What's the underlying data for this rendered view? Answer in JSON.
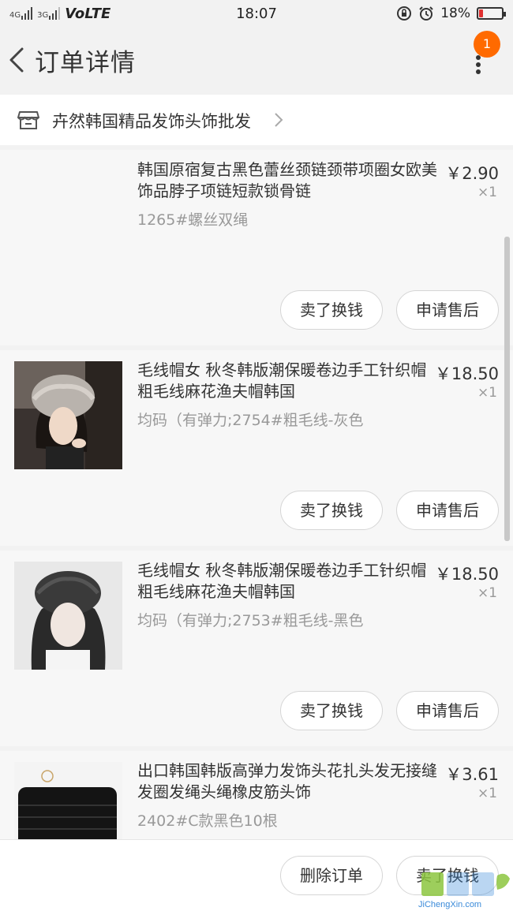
{
  "status_bar": {
    "signal_a": "4G",
    "signal_b": "3G",
    "network": "VoLTE",
    "time": "18:07",
    "battery_percent": "18%",
    "battery_level": 0.18
  },
  "nav": {
    "title": "订单详情",
    "badge_count": "1"
  },
  "shop": {
    "name": "卉然韩国精品发饰头饰批发"
  },
  "items": [
    {
      "title": "韩国原宿复古黑色蕾丝颈链颈带项圈女欧美饰品脖子项链短款锁骨链",
      "sku": "1265#螺丝双绳",
      "price": "￥2.90",
      "qty": "×1",
      "btn_sell": "卖了换钱",
      "btn_after": "申请售后"
    },
    {
      "title": "毛线帽女 秋冬韩版潮保暖卷边手工针织帽粗毛线麻花渔夫帽韩国",
      "sku": "均码（有弹力;2754#粗毛线-灰色",
      "price": "￥18.50",
      "qty": "×1",
      "btn_sell": "卖了换钱",
      "btn_after": "申请售后"
    },
    {
      "title": "毛线帽女 秋冬韩版潮保暖卷边手工针织帽粗毛线麻花渔夫帽韩国",
      "sku": "均码（有弹力;2753#粗毛线-黑色",
      "price": "￥18.50",
      "qty": "×1",
      "btn_sell": "卖了换钱",
      "btn_after": "申请售后"
    },
    {
      "title": "出口韩国韩版高弹力发饰头花扎头发无接缝发圈发绳头绳橡皮筋头饰",
      "sku": "2402#C款黑色10根",
      "price": "￥3.61",
      "qty": "×1"
    }
  ],
  "bottom": {
    "delete_label": "删除订单",
    "sell_label": "卖了换钱"
  },
  "watermark": {
    "text": "JiChengXin.com"
  },
  "colors": {
    "badge": "#ff6a00",
    "battery_low": "#e03030"
  }
}
